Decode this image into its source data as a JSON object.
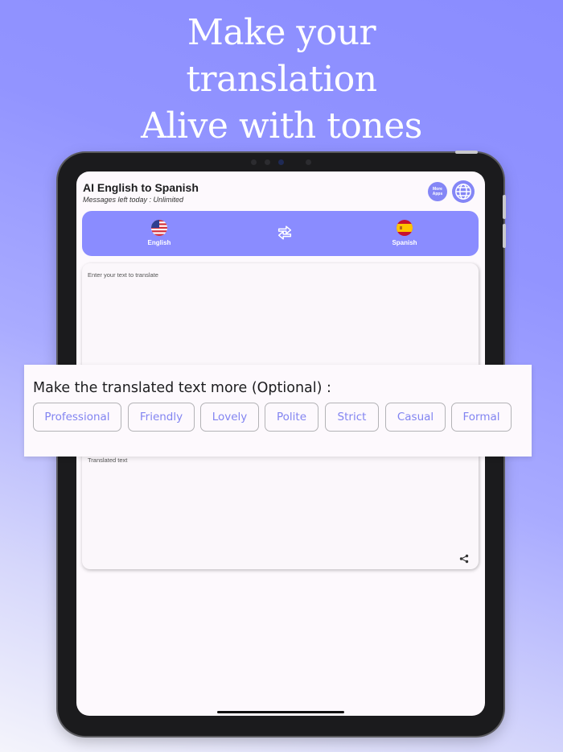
{
  "headline": {
    "line1": "Make your",
    "line2": "translation",
    "line3": "Alive with tones"
  },
  "app": {
    "title": "AI English to Spanish",
    "subtitle": "Messages left today : Unlimited",
    "more_apps_label": "More Apps",
    "globe_icon": "globe-icon"
  },
  "languages": {
    "source": {
      "label": "English",
      "icon": "us-flag-icon"
    },
    "target": {
      "label": "Spanish",
      "icon": "spain-flag-icon"
    },
    "swap_icon": "swap-arrows-icon"
  },
  "input": {
    "placeholder": "Enter your text to translate"
  },
  "tone": {
    "label": "Make the translated text more (Optional) :",
    "options": [
      "Professional",
      "Friendly",
      "Lovely",
      "Polite",
      "Strict",
      "Casual",
      "Formal"
    ]
  },
  "output": {
    "placeholder": "Translated text",
    "share_icon": "share-icon"
  },
  "colors": {
    "accent": "#8a8cff",
    "chip_text": "#8284f1",
    "screen_bg": "#fdf9fd"
  }
}
